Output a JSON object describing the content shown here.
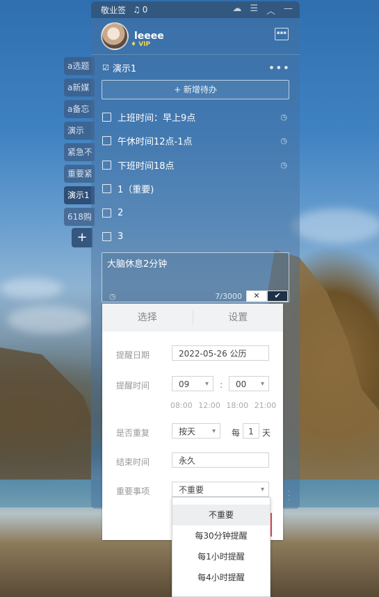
{
  "titlebar": {
    "app_name": "敬业签",
    "notifications": "0"
  },
  "user": {
    "name": "leeee",
    "badge": "VIP"
  },
  "side_tabs": [
    "a选题",
    "a新媒",
    "a备忘",
    "演示",
    "紧急不",
    "重要紧",
    "演示1",
    "618购"
  ],
  "side_add": "+",
  "list": {
    "title": "演示1",
    "add_label": "+ 新增待办",
    "todos": [
      {
        "text": "上班时间：早上9点",
        "has_reminder": true
      },
      {
        "text": "午休时间12点-1点",
        "has_reminder": true
      },
      {
        "text": "下班时间18点",
        "has_reminder": true
      },
      {
        "text": "1（重要)",
        "has_reminder": false
      },
      {
        "text": "2",
        "has_reminder": false
      },
      {
        "text": "3",
        "has_reminder": false
      }
    ]
  },
  "editor": {
    "text": "大脑休息2分钟",
    "count": "7/3000",
    "cancel": "✕",
    "confirm": "✔"
  },
  "reminder_panel": {
    "tabs": [
      "选择",
      "设置"
    ],
    "date_label": "提醒日期",
    "date_value": "2022-05-26  公历",
    "time_label": "提醒时间",
    "hour": "09",
    "minute": "00",
    "quick_times": "08:00 12:00 18:00 21:00",
    "repeat_label": "是否重复",
    "repeat_value": "按天",
    "every": "每",
    "every_n": "1",
    "unit": "天",
    "end_label": "结束时间",
    "end_value": "永久",
    "important_label": "重要事项",
    "important_value": "不重要"
  },
  "dropdown_options": [
    "不重要",
    "每30分钟提醒",
    "每1小时提醒",
    "每4小时提醒"
  ]
}
